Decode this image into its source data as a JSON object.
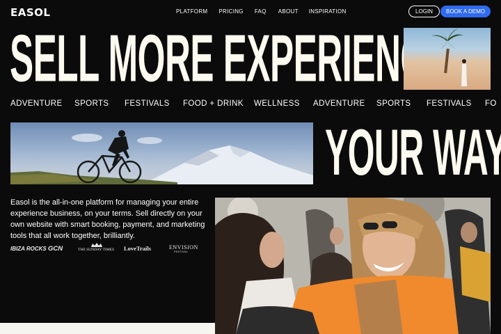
{
  "brand": {
    "logo": "EASOL"
  },
  "nav": {
    "links": [
      "PLATFORM",
      "PRICING",
      "FAQ",
      "ABOUT",
      "INSPIRATION"
    ],
    "login_label": "LOGIN",
    "demo_label": "BOOK A DEMO"
  },
  "hero": {
    "headline_1": "SELL MORE EXPERIENCES",
    "headline_2": "YOUR WAY"
  },
  "ticker": {
    "items": [
      "ADVENTURE",
      "SPORTS",
      "FESTIVALS",
      "FOOD + DRINK",
      "WELLNESS",
      "ADVENTURE",
      "SPORTS",
      "FESTIVALS",
      "FO"
    ]
  },
  "intro": {
    "description": "Easol is the all-in-one platform for managing your entire experience business, on your terms. Sell directly on your own website with smart booking, payment, and marketing tools that all work together, brilliantly."
  },
  "partner_logos": [
    "IBIZA ROCKS",
    "GCN",
    "THE SUNDAY TIMES",
    "LoveTrails",
    "ENVISION"
  ],
  "partner_logo_sub": "FESTIVAL",
  "colors": {
    "background": "#0b0b0b",
    "accent": "#2f6bf0",
    "headline": "#fdfaf0"
  }
}
